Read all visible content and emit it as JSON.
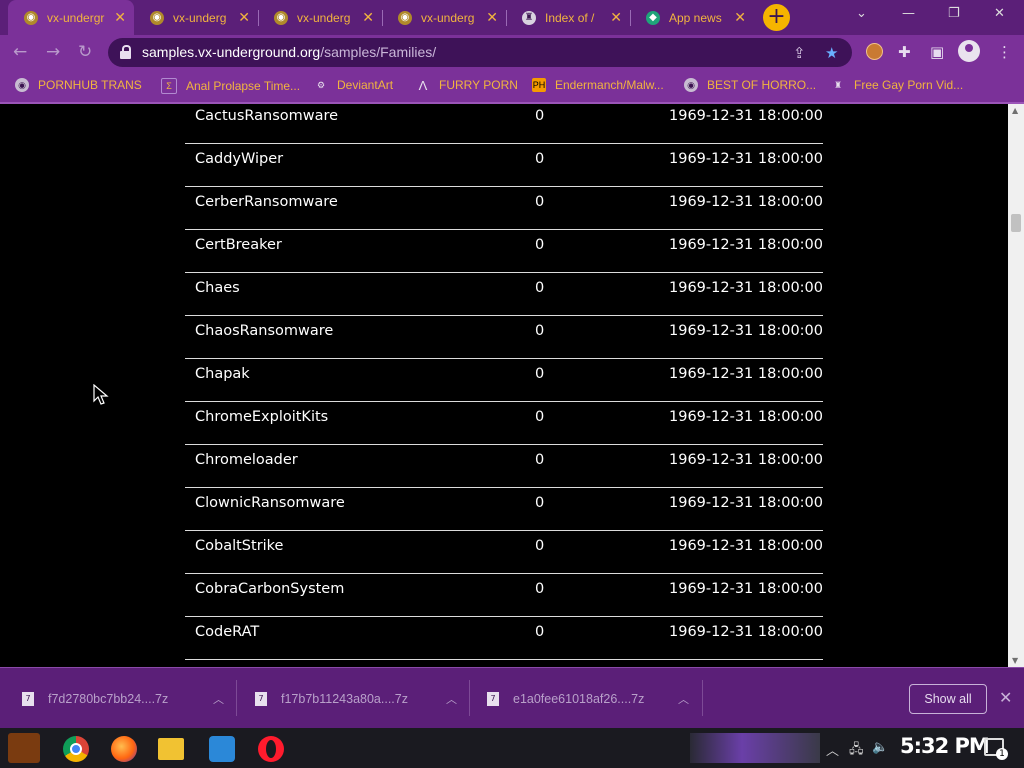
{
  "tabs": [
    {
      "title": "vx-undergr",
      "active": true
    },
    {
      "title": "vx-underg",
      "active": false
    },
    {
      "title": "vx-underg",
      "active": false
    },
    {
      "title": "vx-underg",
      "active": false
    },
    {
      "title": "Index of /",
      "active": false
    },
    {
      "title": "App news",
      "active": false
    }
  ],
  "window_controls": {
    "chevron": "⌄",
    "minimize": "—",
    "restore": "❐",
    "close": "✕"
  },
  "address_bar": {
    "host": "samples.vx-underground.org",
    "path": "/samples/Families/"
  },
  "bookmarks": [
    {
      "label": "PORNHUB TRANS",
      "icon": "globe-icon"
    },
    {
      "label": "Anal Prolapse Time...",
      "icon": "bookmark-favicon"
    },
    {
      "label": "DeviantArt",
      "icon": "deviantart-icon"
    },
    {
      "label": "FURRY PORN",
      "icon": "bookmark-favicon"
    },
    {
      "label": "Endermanch/Malw...",
      "icon": "ph-icon"
    },
    {
      "label": "BEST OF HORRO...",
      "icon": "globe-icon"
    },
    {
      "label": "Free Gay Porn Vid...",
      "icon": "bookmark-favicon"
    }
  ],
  "files": [
    {
      "name": "CactusRansomware",
      "size": "0",
      "date": "1969-12-31 18:00:00"
    },
    {
      "name": "CaddyWiper",
      "size": "0",
      "date": "1969-12-31 18:00:00"
    },
    {
      "name": "CerberRansomware",
      "size": "0",
      "date": "1969-12-31 18:00:00"
    },
    {
      "name": "CertBreaker",
      "size": "0",
      "date": "1969-12-31 18:00:00"
    },
    {
      "name": "Chaes",
      "size": "0",
      "date": "1969-12-31 18:00:00"
    },
    {
      "name": "ChaosRansomware",
      "size": "0",
      "date": "1969-12-31 18:00:00"
    },
    {
      "name": "Chapak",
      "size": "0",
      "date": "1969-12-31 18:00:00"
    },
    {
      "name": "ChromeExploitKits",
      "size": "0",
      "date": "1969-12-31 18:00:00"
    },
    {
      "name": "Chromeloader",
      "size": "0",
      "date": "1969-12-31 18:00:00"
    },
    {
      "name": "ClownicRansomware",
      "size": "0",
      "date": "1969-12-31 18:00:00"
    },
    {
      "name": "CobaltStrike",
      "size": "0",
      "date": "1969-12-31 18:00:00"
    },
    {
      "name": "CobraCarbonSystem",
      "size": "0",
      "date": "1969-12-31 18:00:00"
    },
    {
      "name": "CodeRAT",
      "size": "0",
      "date": "1969-12-31 18:00:00"
    }
  ],
  "downloads": [
    {
      "name": "f7d2780bc7bb24....7z"
    },
    {
      "name": "f17b7b11243a80a....7z"
    },
    {
      "name": "e1a0fee61018af26....7z"
    }
  ],
  "downloads_show_all": "Show all",
  "taskbar": {
    "clock": "5:32 PM",
    "notification_count": "1"
  },
  "colors": {
    "browser_frame": "#5b1f78",
    "toolbar": "#7b3199",
    "accent_text": "#f2b43f",
    "page_background": "#000000"
  }
}
